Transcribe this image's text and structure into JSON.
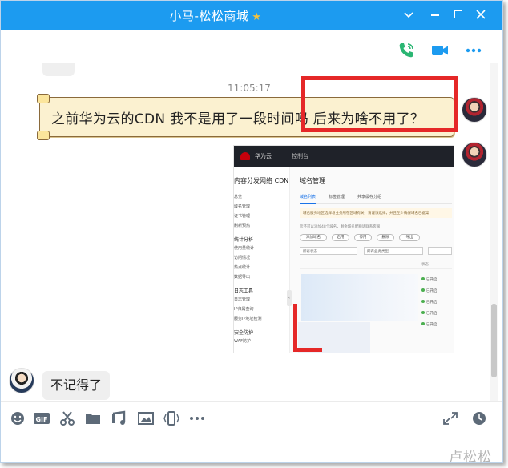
{
  "window": {
    "title": "小马-松松商城",
    "accent_color": "#1c9bf0",
    "title_badge_icon": "star-icon",
    "controls": [
      "dropdown-icon",
      "minimize-icon",
      "maximize-icon",
      "close-icon"
    ]
  },
  "actions": {
    "icons": [
      "voice-call-icon",
      "video-call-icon",
      "more-icon"
    ]
  },
  "chat": {
    "timestamp": "11:05:17",
    "messages": [
      {
        "side": "right",
        "text": "之前华为云的CDN 我不是用了一段时间吗 后来为啥不用了？"
      },
      {
        "side": "right",
        "type": "image"
      },
      {
        "side": "left",
        "text": "不记得了"
      }
    ]
  },
  "screenshot": {
    "brand": "华为云",
    "console": "控制台",
    "side_title": "内容分发网络 CDN",
    "side_items": [
      "总览",
      "域名管理",
      "证书管理",
      "刷新预热"
    ],
    "side_groups": [
      "统计分析",
      "日志工具",
      "安全防护"
    ],
    "side_group1_items": [
      "使用量统计",
      "访问情况",
      "热点统计",
      "数据导出"
    ],
    "side_group2_items": [
      "日志管理",
      "IP归属查询",
      "服务IP地址检测"
    ],
    "side_group3_items": [
      "WAF防护"
    ],
    "heading": "域名管理",
    "tabs": [
      "域名列表",
      "标签管理",
      "共享缓存分组"
    ],
    "warning": "域名服务地区选择与业务所在区域有关，请谨慎选择，并且至少确保域名已备案",
    "note": "您还可以添加48个域名，剩余域名配额请联系客服",
    "buttons": [
      "添加域名",
      "启用",
      "停用",
      "删除",
      "导出"
    ],
    "selects": [
      "所有状态",
      "所有业务类型"
    ],
    "table_header": "状态",
    "statuses": [
      "已开启",
      "已开启",
      "已开启",
      "已开启",
      "已开启"
    ]
  },
  "toolbar": {
    "icons": [
      "emoji-icon",
      "gif-icon",
      "scissors-icon",
      "folder-icon",
      "music-icon",
      "image-icon",
      "shake-icon",
      "more-icon",
      "expand-icon",
      "history-icon"
    ]
  },
  "watermark": "卢松松"
}
